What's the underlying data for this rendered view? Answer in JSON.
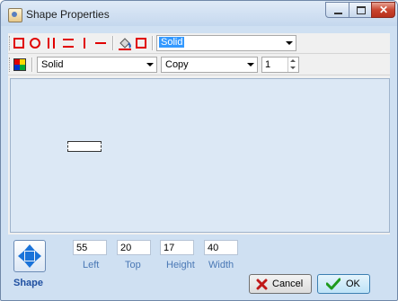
{
  "window": {
    "title": "Shape Properties"
  },
  "toolbar1": {
    "line_style": "Solid"
  },
  "toolbar2": {
    "fill_style": "Solid",
    "mode": "Copy",
    "pen_width": "1"
  },
  "position": {
    "left": "55",
    "top": "20",
    "height": "17",
    "width": "40",
    "left_label": "Left",
    "top_label": "Top",
    "height_label": "Height",
    "width_label": "Width"
  },
  "footer": {
    "section_label": "Shape",
    "cancel_label": "Cancel",
    "ok_label": "OK"
  },
  "icons": [
    "app-icon",
    "minimize-icon",
    "maximize-icon",
    "close-icon",
    "rectangle-icon",
    "circle-icon",
    "vertical-lines-icon",
    "horizontal-lines-icon",
    "vertical-line-icon",
    "horizontal-line-icon",
    "paint-bucket-icon",
    "fill-rect-icon",
    "color-palette-icon",
    "move-arrows-icon",
    "cancel-x-icon",
    "ok-check-icon"
  ],
  "colors": {
    "accent": "#e00000",
    "selection": "#3399ff",
    "canvas": "#dce8f5"
  }
}
